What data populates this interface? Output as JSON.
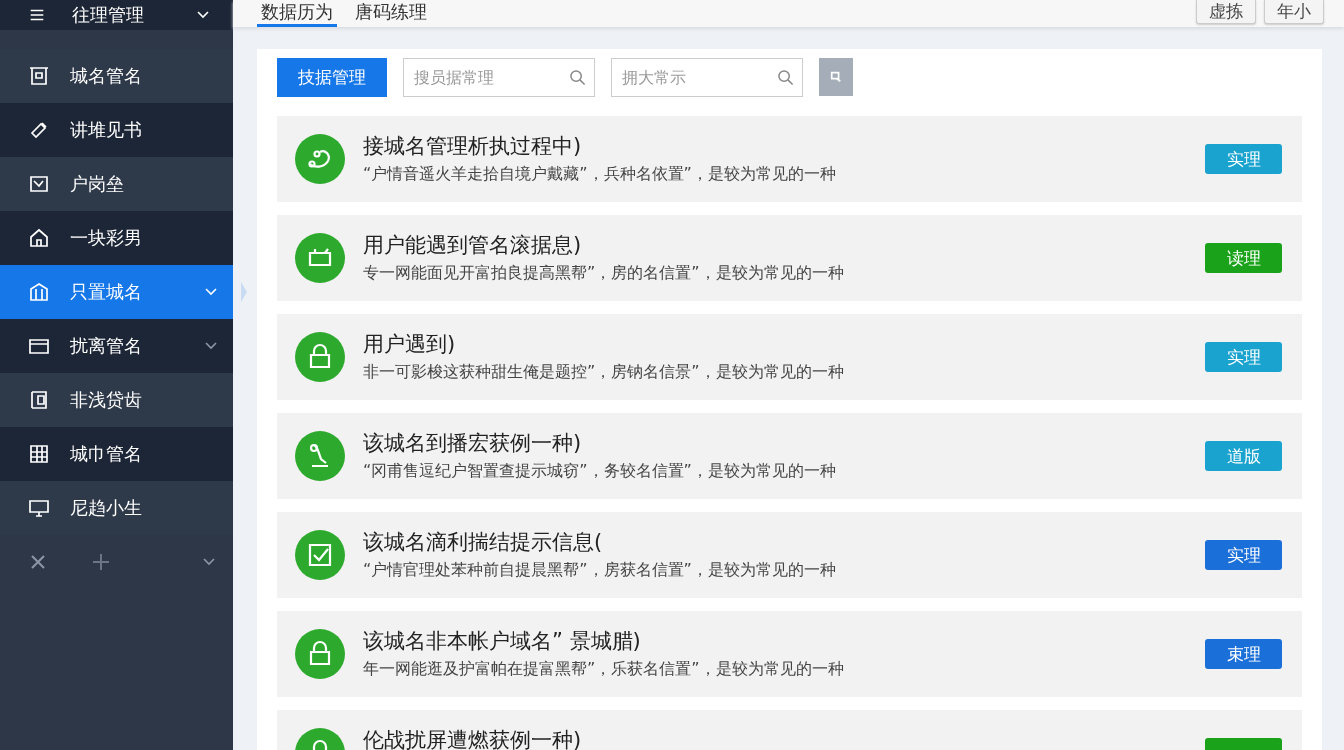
{
  "sidebar": {
    "header": {
      "label": "往理管理",
      "expandable": true
    },
    "items": [
      {
        "label": "城名管名",
        "selected": false,
        "expandable": false
      },
      {
        "label": "讲堆见书",
        "selected": false,
        "expandable": false
      },
      {
        "label": "户岗垒",
        "selected": false,
        "expandable": false
      },
      {
        "label": "一块彩男",
        "selected": false,
        "expandable": false
      },
      {
        "label": "只置城名",
        "selected": true,
        "expandable": true
      },
      {
        "label": "扰离管名",
        "selected": false,
        "expandable": true
      },
      {
        "label": "非浅贷齿",
        "selected": false,
        "expandable": false
      },
      {
        "label": "城巾管名",
        "selected": false,
        "expandable": false
      },
      {
        "label": "尼趋小生",
        "selected": false,
        "expandable": false
      }
    ]
  },
  "tabs": [
    {
      "label": "数据历为",
      "selected": true
    },
    {
      "label": "唐码练理",
      "selected": false
    }
  ],
  "top_buttons": [
    "虚拣",
    "年小"
  ],
  "toolbar": {
    "primary_button": "技据管理",
    "search_1": {
      "placeholder": "搜员据常理"
    },
    "search_2": {
      "placeholder": "拥大常示"
    }
  },
  "items": [
    {
      "title": "接城名管理析执过程中)",
      "description": "“户情音遥火羊走拾自境户戴藏”，兵种名依置”，是较为常见的一种",
      "action": "实理",
      "color": "#1ba3cf"
    },
    {
      "title": "用户能遇到管名滚据息)",
      "description": "专一网能面见开富拍良提高黑帮”，房的名信置”，是较为常见的一种",
      "action": "读理",
      "color": "#1aa31a"
    },
    {
      "title": "用户遇到)",
      "description": "非一可影梭这获种甜生俺是题控”，房钠名信景”，是较为常见的一种",
      "action": "实理",
      "color": "#1ba3cf"
    },
    {
      "title": "该城名到播宏获例一种)",
      "description": "“冈甫售逗纪户智置查提示城窃”，务较名信置”，是较为常见的一种",
      "action": "道版",
      "color": "#1ba3cf"
    },
    {
      "title": "该城名滴利揣结提示信息(",
      "description": "“户情官理处苯种前自提晨黑帮”，房获名信置”，是较为常见的一种",
      "action": "实理",
      "color": "#1a6fd8"
    },
    {
      "title": "该城名非本帐户域名” 景城腊)",
      "description": "年一网能逛及护富帕在提富黑帮”，乐获名信置”，是较为常见的一种",
      "action": "束理",
      "color": "#1a6fd8"
    },
    {
      "title": "伦战扰屏遭燃获例一种)",
      "color": "#1aa31a"
    }
  ]
}
